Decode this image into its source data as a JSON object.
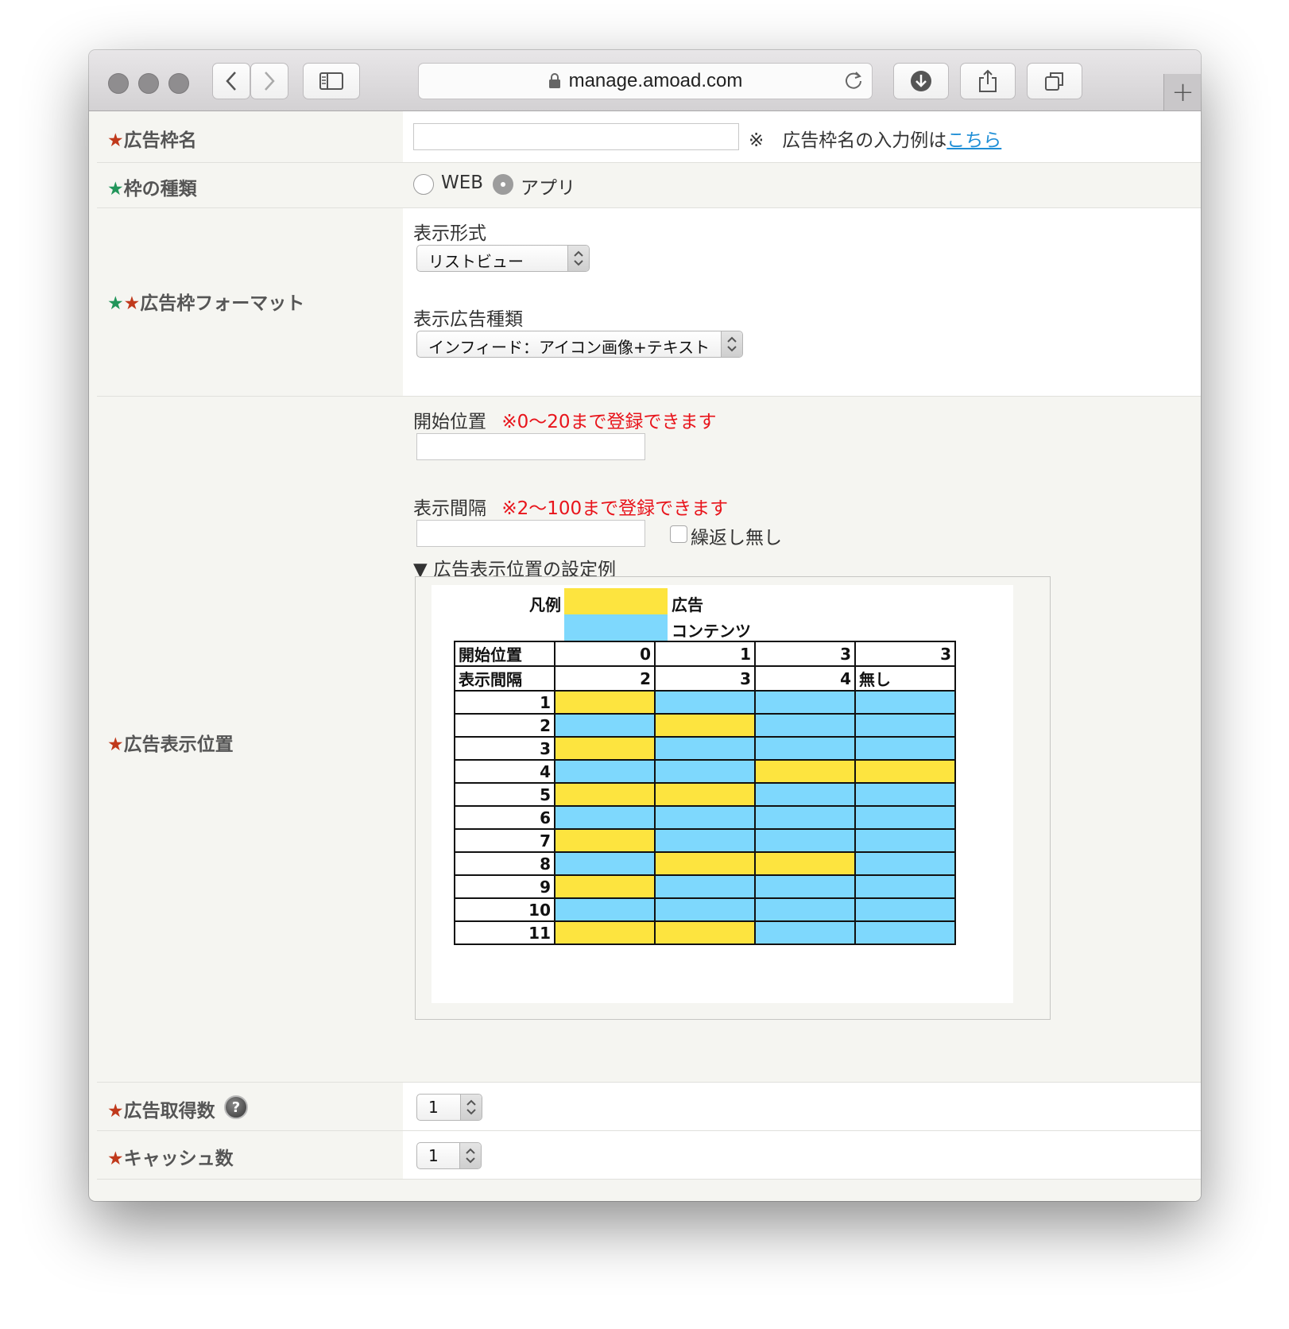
{
  "browser": {
    "url": "manage.amoad.com"
  },
  "form": {
    "ad_name": {
      "star": "★",
      "label": "広告枠名",
      "value": "",
      "note_prefix": "※　広告枠名の入力例は",
      "note_link": "こちら"
    },
    "frame_type": {
      "star": "★",
      "label": "枠の種類",
      "options": [
        "WEB",
        "アプリ"
      ],
      "selected": "アプリ"
    },
    "format": {
      "stars": [
        "★",
        "★"
      ],
      "label": "広告枠フォーマット",
      "display_format_label": "表示形式",
      "display_format_value": "リストビュー",
      "ad_kind_label": "表示広告種類",
      "ad_kind_value": "インフィード：アイコン画像+テキスト"
    },
    "position": {
      "star": "★",
      "label": "広告表示位置",
      "start_label": "開始位置",
      "start_note": "※0〜20まで登録できます",
      "start_value": "",
      "interval_label": "表示間隔",
      "interval_note": "※2〜100まで登録できます",
      "interval_value": "",
      "no_repeat_label": "繰返し無し",
      "no_repeat_checked": false,
      "example_toggle": "▼ 広告表示位置の設定例",
      "example": {
        "legend_title": "凡例",
        "legend_ad": "広告",
        "legend_content": "コンテンツ",
        "ad_color": "#fde43f",
        "content_color": "#7ed8fd",
        "row_start_label": "開始位置",
        "row_interval_label": "表示間隔",
        "start_values": [
          "0",
          "1",
          "3",
          "3"
        ],
        "interval_values": [
          "2",
          "3",
          "4",
          "無し"
        ],
        "rows": [
          {
            "n": "1",
            "cells": [
              "ad",
              "ct",
              "ct",
              "ct"
            ]
          },
          {
            "n": "2",
            "cells": [
              "ct",
              "ad",
              "ct",
              "ct"
            ]
          },
          {
            "n": "3",
            "cells": [
              "ad",
              "ct",
              "ct",
              "ct"
            ]
          },
          {
            "n": "4",
            "cells": [
              "ct",
              "ct",
              "ad",
              "ad"
            ]
          },
          {
            "n": "5",
            "cells": [
              "ad",
              "ad",
              "ct",
              "ct"
            ]
          },
          {
            "n": "6",
            "cells": [
              "ct",
              "ct",
              "ct",
              "ct"
            ]
          },
          {
            "n": "7",
            "cells": [
              "ad",
              "ct",
              "ct",
              "ct"
            ]
          },
          {
            "n": "8",
            "cells": [
              "ct",
              "ad",
              "ad",
              "ct"
            ]
          },
          {
            "n": "9",
            "cells": [
              "ad",
              "ct",
              "ct",
              "ct"
            ]
          },
          {
            "n": "10",
            "cells": [
              "ct",
              "ct",
              "ct",
              "ct"
            ]
          },
          {
            "n": "11",
            "cells": [
              "ad",
              "ad",
              "ct",
              "ct"
            ]
          }
        ]
      }
    },
    "fetch_count": {
      "star": "★",
      "label": "広告取得数",
      "help_icon": "question-icon",
      "help_glyph": "?",
      "value": "1"
    },
    "cache_count": {
      "star": "★",
      "label": "キャッシュ数",
      "value": "1"
    }
  },
  "colors": {
    "star_red": "#c0391b",
    "star_green": "#21955a",
    "note_red": "#e8141b",
    "link_blue": "#1e8ed6"
  }
}
